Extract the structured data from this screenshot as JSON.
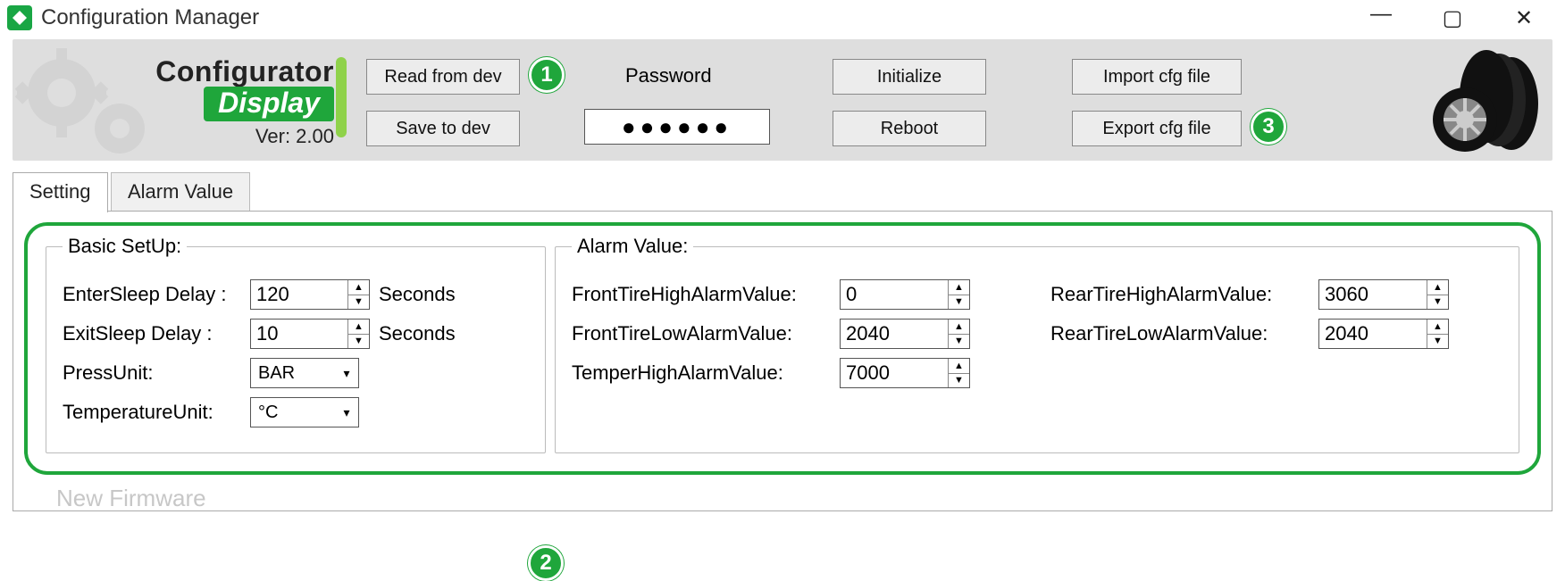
{
  "window": {
    "title": "Configuration Manager"
  },
  "header": {
    "brand_line1": "Configurator",
    "brand_line2": "Display",
    "version": "Ver: 2.00",
    "read_label": "Read from dev",
    "save_label": "Save to dev",
    "password_label": "Password",
    "password_value": "●●●●●●",
    "initialize_label": "Initialize",
    "reboot_label": "Reboot",
    "import_label": "Import cfg file",
    "export_label": "Export cfg file"
  },
  "callouts": {
    "c1": "1",
    "c2": "2",
    "c3": "3"
  },
  "tabs": {
    "setting": "Setting",
    "alarm": "Alarm Value"
  },
  "basic": {
    "legend": "Basic SetUp:",
    "enter_sleep_label": "EnterSleep Delay :",
    "enter_sleep_value": "120",
    "enter_sleep_unit": "Seconds",
    "exit_sleep_label": "ExitSleep Delay :",
    "exit_sleep_value": "10",
    "exit_sleep_unit": "Seconds",
    "press_unit_label": "PressUnit:",
    "press_unit_value": "BAR",
    "temp_unit_label": "TemperatureUnit:",
    "temp_unit_value": "°C"
  },
  "alarm": {
    "legend": "Alarm Value:",
    "front_high_label": "FrontTireHighAlarmValue:",
    "front_high_value": "0",
    "front_low_label": "FrontTireLowAlarmValue:",
    "front_low_value": "2040",
    "temper_high_label": "TemperHighAlarmValue:",
    "temper_high_value": "7000",
    "rear_high_label": "RearTireHighAlarmValue:",
    "rear_high_value": "3060",
    "rear_low_label": "RearTireLowAlarmValue:",
    "rear_low_value": "2040"
  },
  "footer_ghost": "New Firmware"
}
